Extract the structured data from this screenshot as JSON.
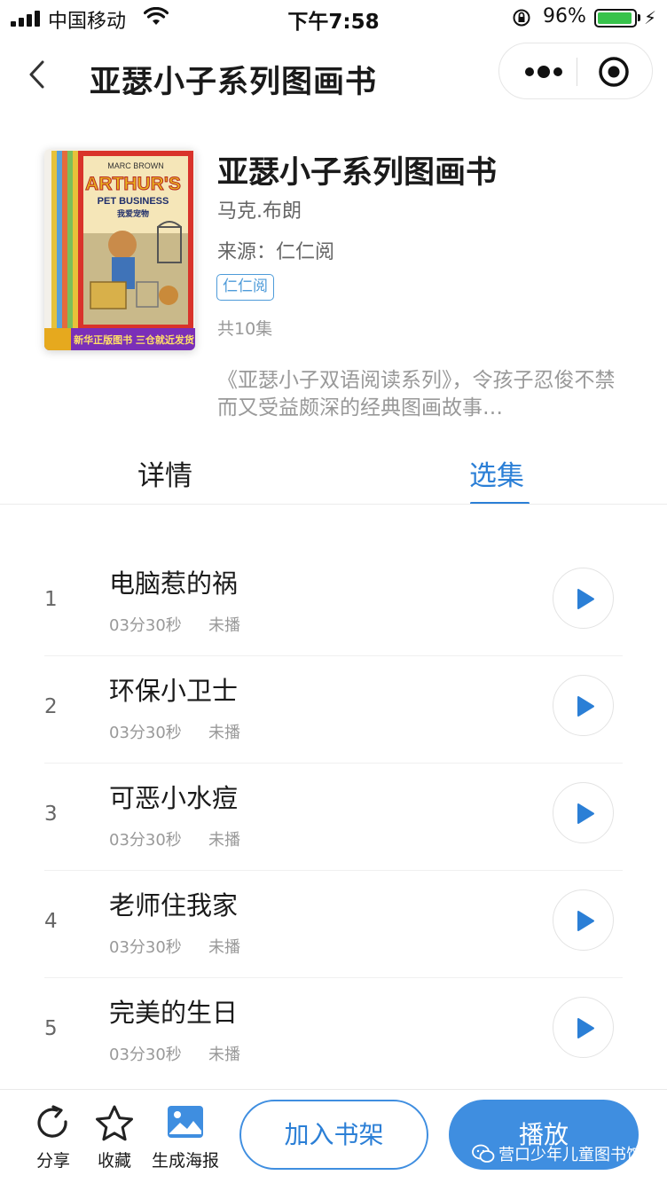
{
  "status_bar": {
    "carrier": "中国移动",
    "time": "下午7:58",
    "battery_percent": "96%",
    "battery_level": 0.96,
    "icons": [
      "signal-icon",
      "wifi-icon",
      "orientation-lock-icon",
      "battery-icon",
      "charging-icon"
    ]
  },
  "nav": {
    "title": "亚瑟小子系列图画书",
    "icons": [
      "back-icon",
      "more-icon",
      "close-miniprogram-icon"
    ]
  },
  "book": {
    "cover_text": {
      "author_brand": "MARC BROWN",
      "title_line1": "ARTHUR'S",
      "title_line2": "PET BUSINESS",
      "subtitle": "我爱宠物",
      "banner": "新华正版图书 三仓就近发货"
    },
    "title": "亚瑟小子系列图画书",
    "author": "马克.布朗",
    "source": "来源：仁仁阅",
    "tag": "仁仁阅",
    "episode_count": "共10集",
    "description": "《亚瑟小子双语阅读系列》，令孩子忍俊不禁而又受益颇深的经典图画故事…"
  },
  "tabs": [
    {
      "label": "详情",
      "active": false
    },
    {
      "label": "选集",
      "active": true
    }
  ],
  "episodes": [
    {
      "num": "1",
      "title": "电脑惹的祸",
      "duration": "03分30秒",
      "state": "未播"
    },
    {
      "num": "2",
      "title": "环保小卫士",
      "duration": "03分30秒",
      "state": "未播"
    },
    {
      "num": "3",
      "title": "可恶小水痘",
      "duration": "03分30秒",
      "state": "未播"
    },
    {
      "num": "4",
      "title": "老师住我家",
      "duration": "03分30秒",
      "state": "未播"
    },
    {
      "num": "5",
      "title": "完美的生日",
      "duration": "03分30秒",
      "state": "未播"
    }
  ],
  "bottom_bar": {
    "share_label": "分享",
    "favorite_label": "收藏",
    "poster_label": "生成海报",
    "shelf_button": "加入书架",
    "play_button": "播放"
  },
  "watermark": "营口少年儿童图书馆",
  "colors": {
    "accent": "#2b7fd6",
    "button_blue": "#3f8ee0",
    "text_primary": "#1a1a1a",
    "text_muted": "#999999",
    "battery_green": "#37c24b"
  }
}
